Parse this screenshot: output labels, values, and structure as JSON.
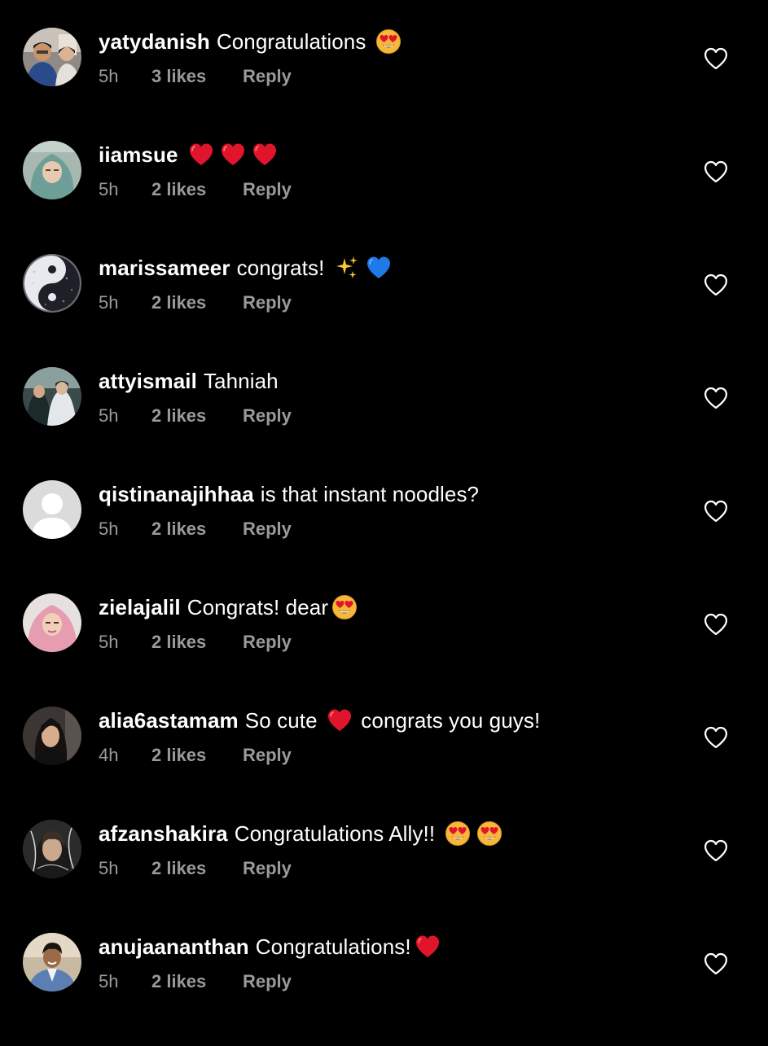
{
  "comments": [
    {
      "username": "yatydanish",
      "parts": [
        {
          "t": "Congratulations "
        },
        {
          "e": "heart-eyes"
        }
      ],
      "time": "5h",
      "likes": "3 likes",
      "reply": "Reply",
      "avatar": "photo-couple-icon"
    },
    {
      "username": "iiamsue",
      "parts": [
        {
          "e": "red-heart"
        },
        {
          "e": "red-heart"
        },
        {
          "e": "red-heart"
        }
      ],
      "time": "5h",
      "likes": "2 likes",
      "reply": "Reply",
      "avatar": "photo-hijab-icon"
    },
    {
      "username": "marissameer",
      "parts": [
        {
          "t": "congrats! "
        },
        {
          "e": "sparkles"
        },
        {
          "e": "blue-heart"
        }
      ],
      "time": "5h",
      "likes": "2 likes",
      "reply": "Reply",
      "avatar": "photo-yinyang-icon"
    },
    {
      "username": "attyismail",
      "parts": [
        {
          "t": "Tahniah"
        }
      ],
      "time": "5h",
      "likes": "2 likes",
      "reply": "Reply",
      "avatar": "photo-group-icon"
    },
    {
      "username": "qistinanajihhaa",
      "parts": [
        {
          "t": "is that instant noodles?"
        }
      ],
      "time": "5h",
      "likes": "2 likes",
      "reply": "Reply",
      "avatar": "default-avatar-icon"
    },
    {
      "username": "zielajalil",
      "parts": [
        {
          "t": "Congrats! dear"
        },
        {
          "e": "heart-eyes"
        }
      ],
      "time": "5h",
      "likes": "2 likes",
      "reply": "Reply",
      "avatar": "photo-pink-hijab-icon"
    },
    {
      "username": "alia6astamam",
      "parts": [
        {
          "t": "So cute "
        },
        {
          "e": "red-heart"
        },
        {
          "t": " congrats you guys!"
        }
      ],
      "time": "4h",
      "likes": "2 likes",
      "reply": "Reply",
      "avatar": "photo-portrait-dark-icon"
    },
    {
      "username": "afzanshakira",
      "parts": [
        {
          "t": "Congratulations Ally!! "
        },
        {
          "e": "heart-eyes"
        },
        {
          "e": "heart-eyes"
        }
      ],
      "time": "5h",
      "likes": "2 likes",
      "reply": "Reply",
      "avatar": "photo-sketch-icon"
    },
    {
      "username": "anujaananthan",
      "parts": [
        {
          "t": "Congratulations!"
        },
        {
          "e": "red-heart"
        }
      ],
      "time": "5h",
      "likes": "2 likes",
      "reply": "Reply",
      "avatar": "photo-jacket-icon"
    }
  ],
  "colors": {
    "background": "#000000",
    "text": "#ffffff",
    "meta": "#9a9a9a",
    "heart_red": "#e0152b",
    "heart_blue": "#1f7ae8",
    "emoji_yellow": "#f6b83a"
  }
}
